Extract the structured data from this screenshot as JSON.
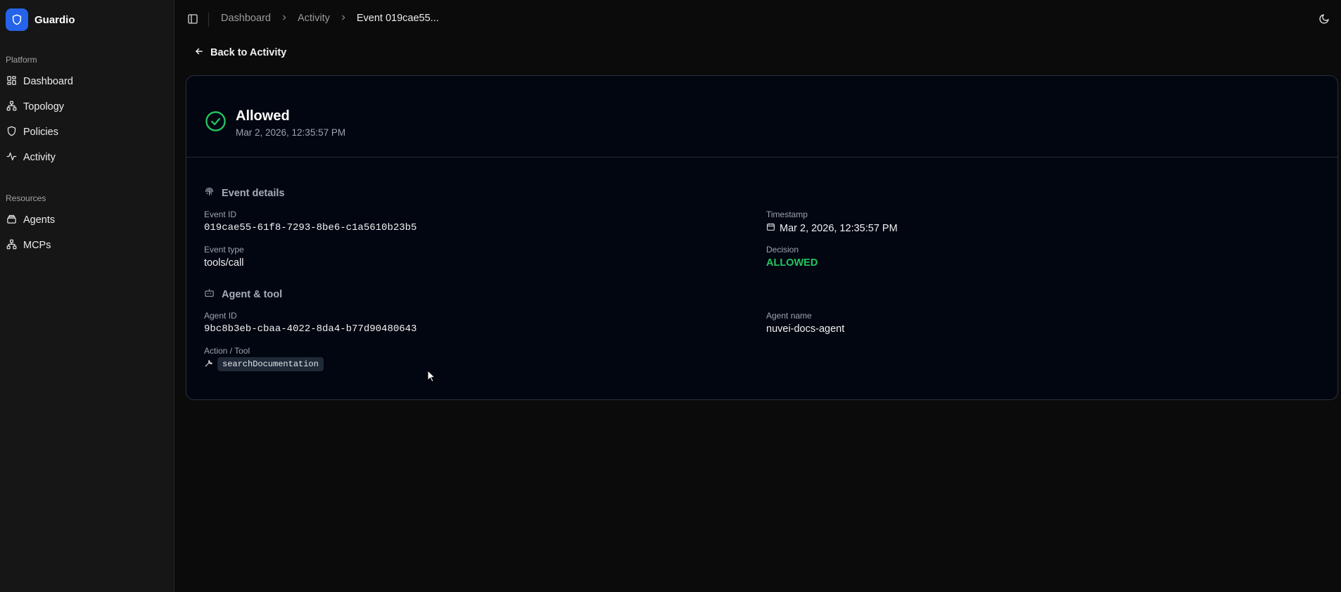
{
  "app": {
    "name": "Guardio"
  },
  "sidebar": {
    "platform_label": "Platform",
    "platform_items": [
      {
        "label": "Dashboard",
        "icon": "grid-icon"
      },
      {
        "label": "Topology",
        "icon": "topology-icon"
      },
      {
        "label": "Policies",
        "icon": "shield-icon"
      },
      {
        "label": "Activity",
        "icon": "activity-icon"
      }
    ],
    "resources_label": "Resources",
    "resources_items": [
      {
        "label": "Agents",
        "icon": "agents-icon"
      },
      {
        "label": "MCPs",
        "icon": "topology-icon"
      }
    ]
  },
  "header": {
    "breadcrumb": [
      "Dashboard",
      "Activity",
      "Event 019cae55..."
    ]
  },
  "back_link": "Back to Activity",
  "event": {
    "status": "Allowed",
    "status_time": "Mar 2, 2026, 12:35:57 PM",
    "details_title": "Event details",
    "event_id_label": "Event ID",
    "event_id": "019cae55-61f8-7293-8be6-c1a5610b23b5",
    "timestamp_label": "Timestamp",
    "timestamp": "Mar 2, 2026, 12:35:57 PM",
    "event_type_label": "Event type",
    "event_type": "tools/call",
    "decision_label": "Decision",
    "decision": "ALLOWED",
    "agent_tool_title": "Agent & tool",
    "agent_id_label": "Agent ID",
    "agent_id": "9bc8b3eb-cbaa-4022-8da4-b77d90480643",
    "agent_name_label": "Agent name",
    "agent_name": "nuvei-docs-agent",
    "action_label": "Action / Tool",
    "action_tool": "searchDocumentation"
  },
  "colors": {
    "accent": "#2563eb",
    "allowed": "#22c55e",
    "card_bg": "#020611",
    "page_bg": "#0b0b0b",
    "sidebar_bg": "#161616"
  }
}
